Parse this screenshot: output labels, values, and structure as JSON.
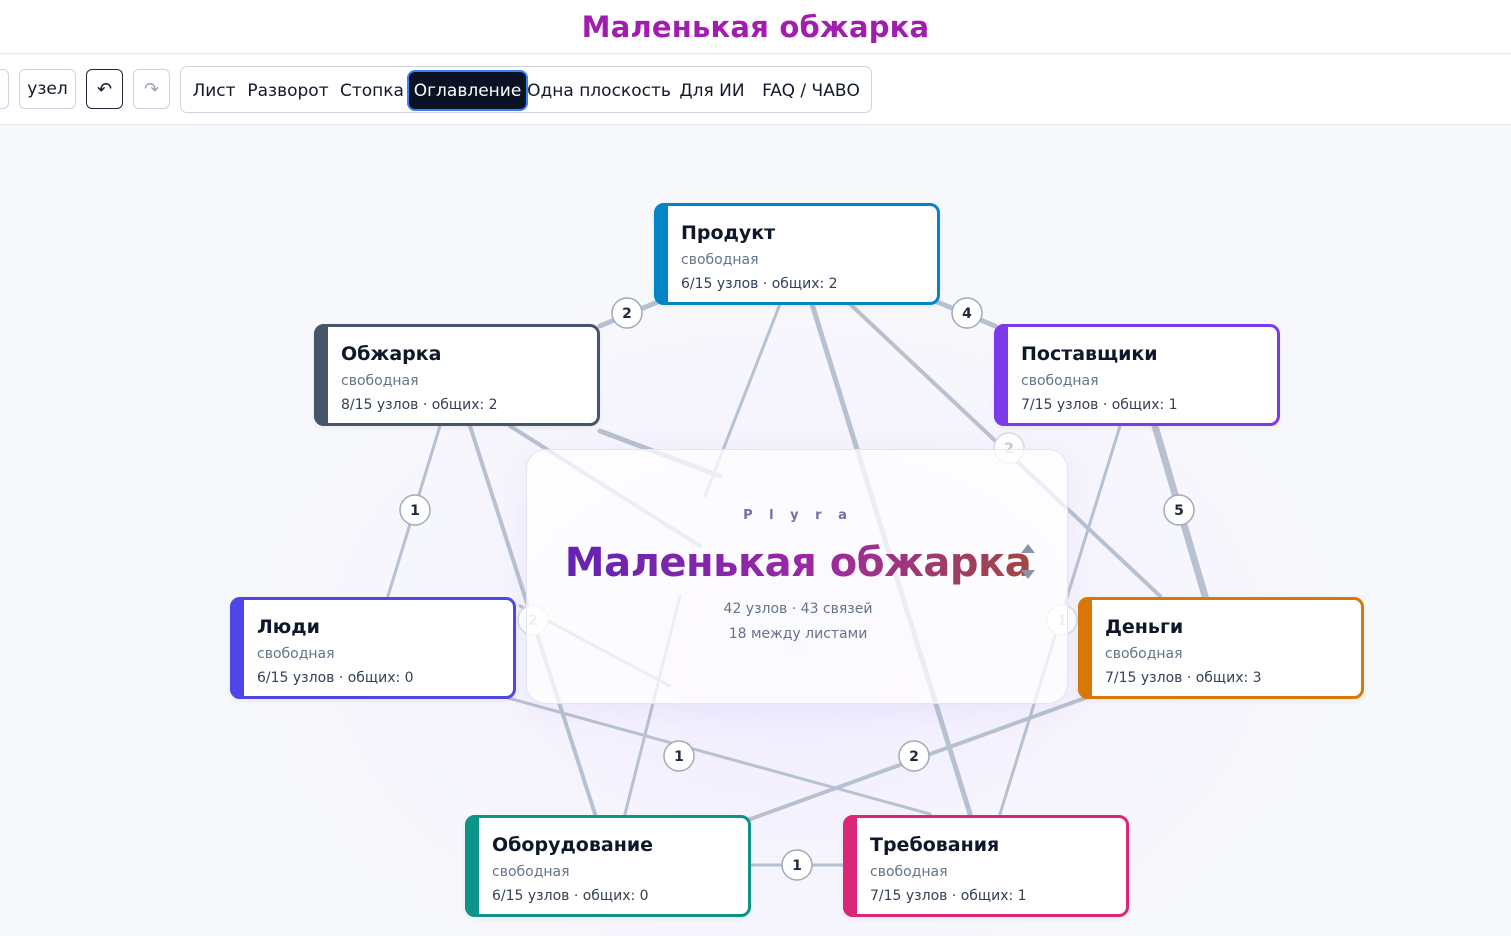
{
  "app_title": "Маленькая обжарка",
  "toolbar": {
    "node_button": "узел",
    "undo_icon": "↶",
    "redo_icon": "↷",
    "views": [
      "Лист",
      "Разворот",
      "Стопка",
      "Оглавление",
      "Одна плоскость",
      "Для ИИ",
      "FAQ / ЧАВО"
    ],
    "active_view": "Оглавление"
  },
  "center": {
    "brand": "P l y r a",
    "title": "Маленькая обжарка",
    "stats_line1": "42 узлов · 43 связей",
    "stats_line2": "18 между листами"
  },
  "colors": {
    "title": "#a21caf",
    "active_tab": "#0b1224",
    "edge": "#b8c1d1"
  },
  "sheets": [
    {
      "id": "product",
      "name": "Продукт",
      "type": "свободная",
      "stats": "6/15 узлов · общих: 2",
      "color": "#0284c7"
    },
    {
      "id": "roasting",
      "name": "Обжарка",
      "type": "свободная",
      "stats": "8/15 узлов · общих: 2",
      "color": "#475569"
    },
    {
      "id": "suppliers",
      "name": "Поставщики",
      "type": "свободная",
      "stats": "7/15 узлов · общих: 1",
      "color": "#7c3aed"
    },
    {
      "id": "people",
      "name": "Люди",
      "type": "свободная",
      "stats": "6/15 узлов · общих: 0",
      "color": "#4f46e5"
    },
    {
      "id": "money",
      "name": "Деньги",
      "type": "свободная",
      "stats": "7/15 узлов · общих: 3",
      "color": "#d97706"
    },
    {
      "id": "equipment",
      "name": "Оборудование",
      "type": "свободная",
      "stats": "6/15 узлов · общих: 0",
      "color": "#0d9488"
    },
    {
      "id": "requirements",
      "name": "Требования",
      "type": "свободная",
      "stats": "7/15 узлов · общих: 1",
      "color": "#db2777"
    }
  ],
  "links": [
    {
      "a": "roasting",
      "b": "product",
      "count": "2"
    },
    {
      "a": "product",
      "b": "suppliers",
      "count": "4"
    },
    {
      "a": "roasting",
      "b": "people",
      "count": "1"
    },
    {
      "a": "suppliers",
      "b": "money",
      "count": "5"
    },
    {
      "a": "product",
      "b": "money",
      "count": "2"
    },
    {
      "a": "people",
      "b": "requirements",
      "count": "1"
    },
    {
      "a": "money",
      "b": "equipment",
      "count": "2"
    },
    {
      "a": "equipment",
      "b": "requirements",
      "count": "1"
    },
    {
      "a": "people",
      "b": "money",
      "count": "1"
    },
    {
      "a": "roasting",
      "b": "equipment",
      "count": "2"
    }
  ]
}
